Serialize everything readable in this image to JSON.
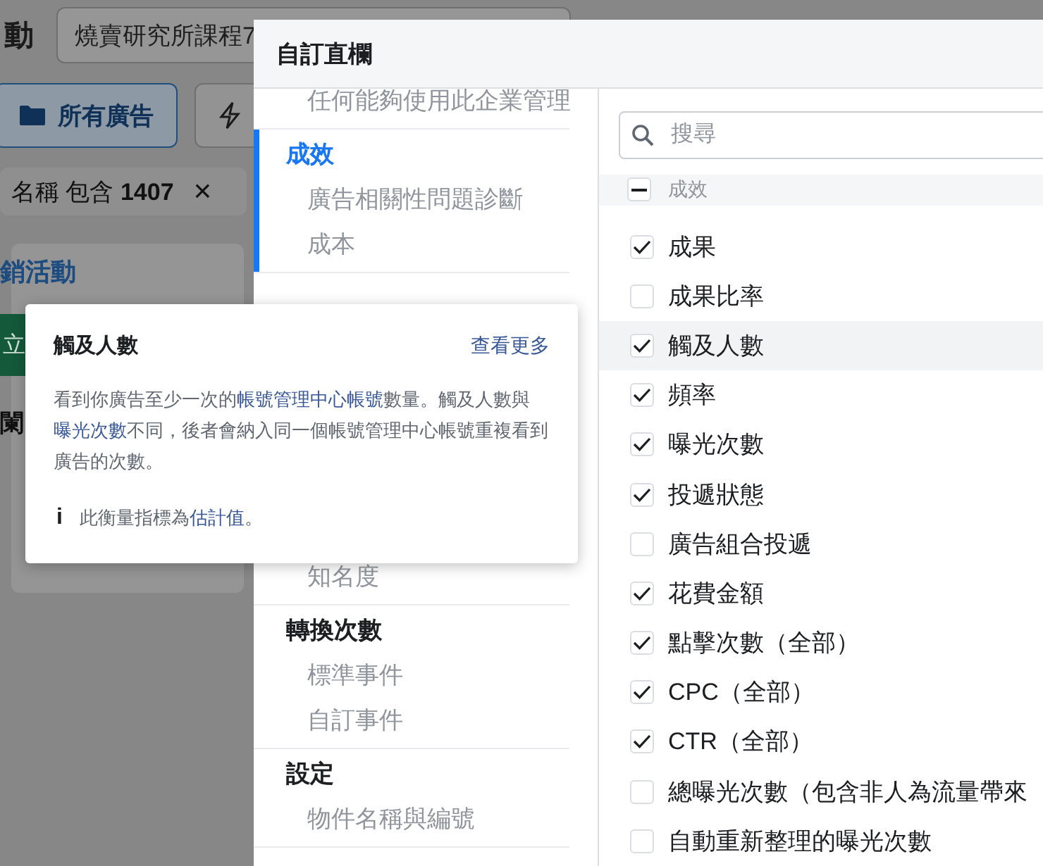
{
  "background": {
    "page_title": "動",
    "account_field": {
      "value": "燒賣研究所課程7"
    },
    "buttons": [
      {
        "label": "所有廣告",
        "kind": "folder",
        "selected": true
      },
      {
        "kind": "bolt",
        "selected": false
      }
    ],
    "filter_chip": {
      "text": "名稱 包含 **1407**",
      "close": "×"
    },
    "card": {
      "title": "銷活動",
      "button": "立",
      "text": "闌"
    }
  },
  "dialog": {
    "title": "自訂直欄",
    "nav": [
      {
        "items": [
          {
            "label": "任何能夠使用此企業管理"
          }
        ]
      },
      {
        "title": "成效",
        "selected": true,
        "items": [
          {
            "label": "廣告相關性問題診斷"
          },
          {
            "label": "成本"
          }
        ]
      },
      {
        "selected": false,
        "items": [
          {
            "label": "知名度"
          }
        ]
      },
      {
        "title": "轉換次數",
        "selected": false,
        "items": [
          {
            "label": "標準事件"
          },
          {
            "label": "自訂事件"
          }
        ]
      },
      {
        "title": "設定",
        "selected": false,
        "items": [
          {
            "label": "物件名稱與編號"
          }
        ]
      }
    ],
    "search": {
      "placeholder": "搜尋"
    },
    "group": {
      "label": "成效",
      "indeterminate": true
    },
    "columns": [
      {
        "label": "成果",
        "checked": true,
        "highlighted": false
      },
      {
        "label": "成果比率",
        "checked": false,
        "highlighted": false
      },
      {
        "label": "觸及人數",
        "checked": true,
        "highlighted": true
      },
      {
        "label": "頻率",
        "checked": true,
        "highlighted": false
      },
      {
        "label": "曝光次數",
        "checked": true,
        "highlighted": false
      },
      {
        "label": "投遞狀態",
        "checked": true,
        "highlighted": false
      },
      {
        "label": "廣告組合投遞",
        "checked": false,
        "highlighted": false
      },
      {
        "label": "花費金額",
        "checked": true,
        "highlighted": false
      },
      {
        "label": "點擊次數（全部）",
        "checked": true,
        "highlighted": false
      },
      {
        "label": "CPC（全部）",
        "checked": true,
        "highlighted": false
      },
      {
        "label": "CTR（全部）",
        "checked": true,
        "highlighted": false
      },
      {
        "label": "總曝光次數（包含非人為流量帶來",
        "checked": false,
        "highlighted": false
      },
      {
        "label": "自動重新整理的曝光次數",
        "checked": false,
        "highlighted": false
      }
    ]
  },
  "tooltip": {
    "title": "觸及人數",
    "more_link": "查看更多",
    "body": [
      {
        "text": "看到你廣告至少一次的",
        "kind": "text"
      },
      {
        "text": "帳號管理中心帳號",
        "kind": "link"
      },
      {
        "text": "數量。觸及人數與",
        "kind": "text"
      },
      {
        "text": "曝光次數",
        "kind": "link"
      },
      {
        "text": "不同，後者會納入同一個帳號管理中心帳號重複看到廣告的次數。",
        "kind": "text"
      }
    ],
    "note": [
      {
        "text": "此衡量指標為",
        "kind": "text"
      },
      {
        "text": "估計值",
        "kind": "link"
      },
      {
        "text": "。",
        "kind": "text"
      }
    ],
    "note_icon": "i"
  }
}
